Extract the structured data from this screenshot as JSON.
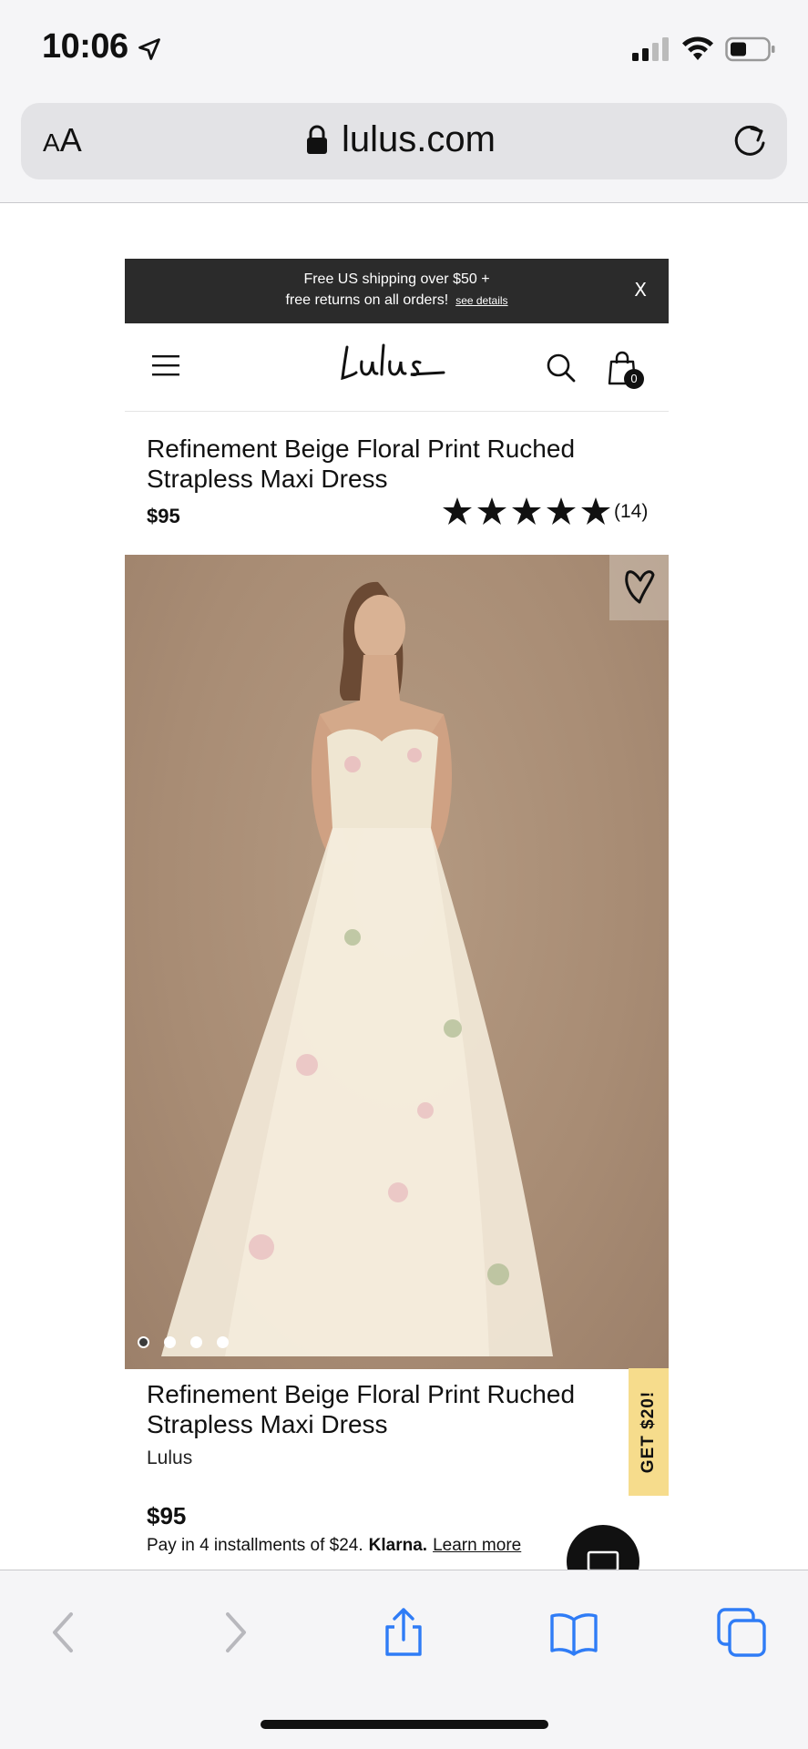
{
  "status_bar": {
    "time": "10:06"
  },
  "browser": {
    "text_size_label": "AA",
    "url": "lulus.com"
  },
  "promo_banner": {
    "line1": "Free US shipping over $50 +",
    "line2": "free returns on all orders!",
    "link": "see details",
    "close": "X"
  },
  "header": {
    "logo": "Lulus",
    "cart_count": "0"
  },
  "product": {
    "title": "Refinement Beige Floral Print Ruched Strapless Maxi Dress",
    "price": "$95",
    "rating_stars": 5,
    "review_count": "(14)",
    "brand": "Lulus",
    "image_count": 4,
    "active_image": 1
  },
  "klarna": {
    "text": "Pay in 4 installments of $24.",
    "logo": "Klarna.",
    "link": "Learn more"
  },
  "side_tab": {
    "label": "GET $20!"
  },
  "colors": {
    "promo_bg": "#2b2b2b",
    "side_tab_bg": "#f6dc8c",
    "toolbar_blue": "#2f7cf6"
  }
}
